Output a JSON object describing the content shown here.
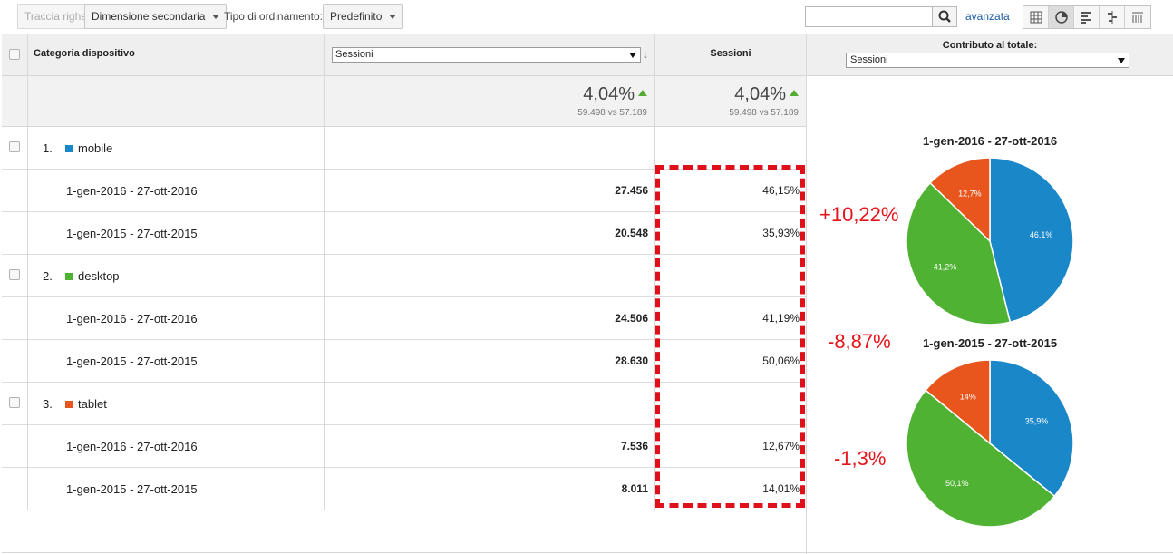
{
  "toolbar": {
    "plot_rows": "Traccia righe",
    "secondary_dimension": "Dimensione secondaria",
    "sort_type_label": "Tipo di ordinamento:",
    "sort_type_value": "Predefinito",
    "search_placeholder": "",
    "advanced_link": "avanzata"
  },
  "table": {
    "dimension_header": "Categoria dispositivo",
    "metric_select": "Sessioni",
    "sessions_header": "Sessioni",
    "totals": {
      "change_a": "4,04%",
      "compare_a": "59.498 vs 57.189",
      "change_b": "4,04%",
      "compare_b": "59.498 vs 57.189"
    },
    "groups": [
      {
        "index": "1.",
        "name": "mobile",
        "color": "#1a87c9",
        "rows": [
          {
            "period": "1-gen-2016 - 27-ott-2016",
            "value": "27.456",
            "share": "46,15%"
          },
          {
            "period": "1-gen-2015 - 27-ott-2015",
            "value": "20.548",
            "share": "35,93%"
          }
        ]
      },
      {
        "index": "2.",
        "name": "desktop",
        "color": "#4fb233",
        "rows": [
          {
            "period": "1-gen-2016 - 27-ott-2016",
            "value": "24.506",
            "share": "41,19%"
          },
          {
            "period": "1-gen-2015 - 27-ott-2015",
            "value": "28.630",
            "share": "50,06%"
          }
        ]
      },
      {
        "index": "3.",
        "name": "tablet",
        "color": "#e8561d",
        "rows": [
          {
            "period": "1-gen-2016 - 27-ott-2016",
            "value": "7.536",
            "share": "12,67%"
          },
          {
            "period": "1-gen-2015 - 27-ott-2015",
            "value": "8.011",
            "share": "14,01%"
          }
        ]
      }
    ]
  },
  "contribution": {
    "title": "Contributo al totale:",
    "select_value": "Sessioni"
  },
  "annotations": {
    "mobile_change": "+10,22%",
    "desktop_change": "-8,87%",
    "tablet_change": "-1,3%"
  },
  "chart_data": [
    {
      "type": "pie",
      "title": "1-gen-2016 - 27-ott-2016",
      "categories": [
        "mobile",
        "desktop",
        "tablet"
      ],
      "values": [
        46.1,
        41.2,
        12.7
      ],
      "labels": [
        "46,1%",
        "41,2%",
        "12,7%"
      ],
      "colors": [
        "#1a87c9",
        "#4fb233",
        "#e8561d"
      ]
    },
    {
      "type": "pie",
      "title": "1-gen-2015 - 27-ott-2015",
      "categories": [
        "mobile",
        "desktop",
        "tablet"
      ],
      "values": [
        35.9,
        50.1,
        14.0
      ],
      "labels": [
        "35,9%",
        "50,1%",
        "14%"
      ],
      "colors": [
        "#1a87c9",
        "#4fb233",
        "#e8561d"
      ]
    }
  ]
}
